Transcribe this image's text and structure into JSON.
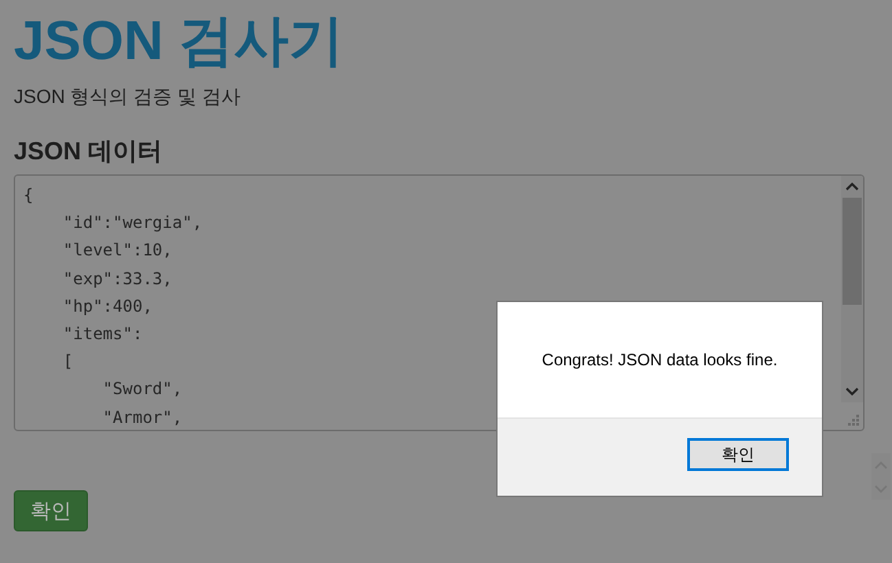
{
  "page": {
    "title": "JSON 검사기",
    "subtitle": "JSON 형식의 검증 및 검사"
  },
  "editor": {
    "heading": "JSON 데이터",
    "lines": [
      "{",
      "    \"id\":\"wergia\",",
      "    \"level\":10,",
      "    \"exp\":33.3,",
      "    \"hp\":400,",
      "    \"items\":",
      "    [",
      "        \"Sword\",",
      "        \"Armor\","
    ]
  },
  "submit_button": "확인",
  "dialog": {
    "message": "Congrats! JSON data looks fine.",
    "button": "확인"
  }
}
